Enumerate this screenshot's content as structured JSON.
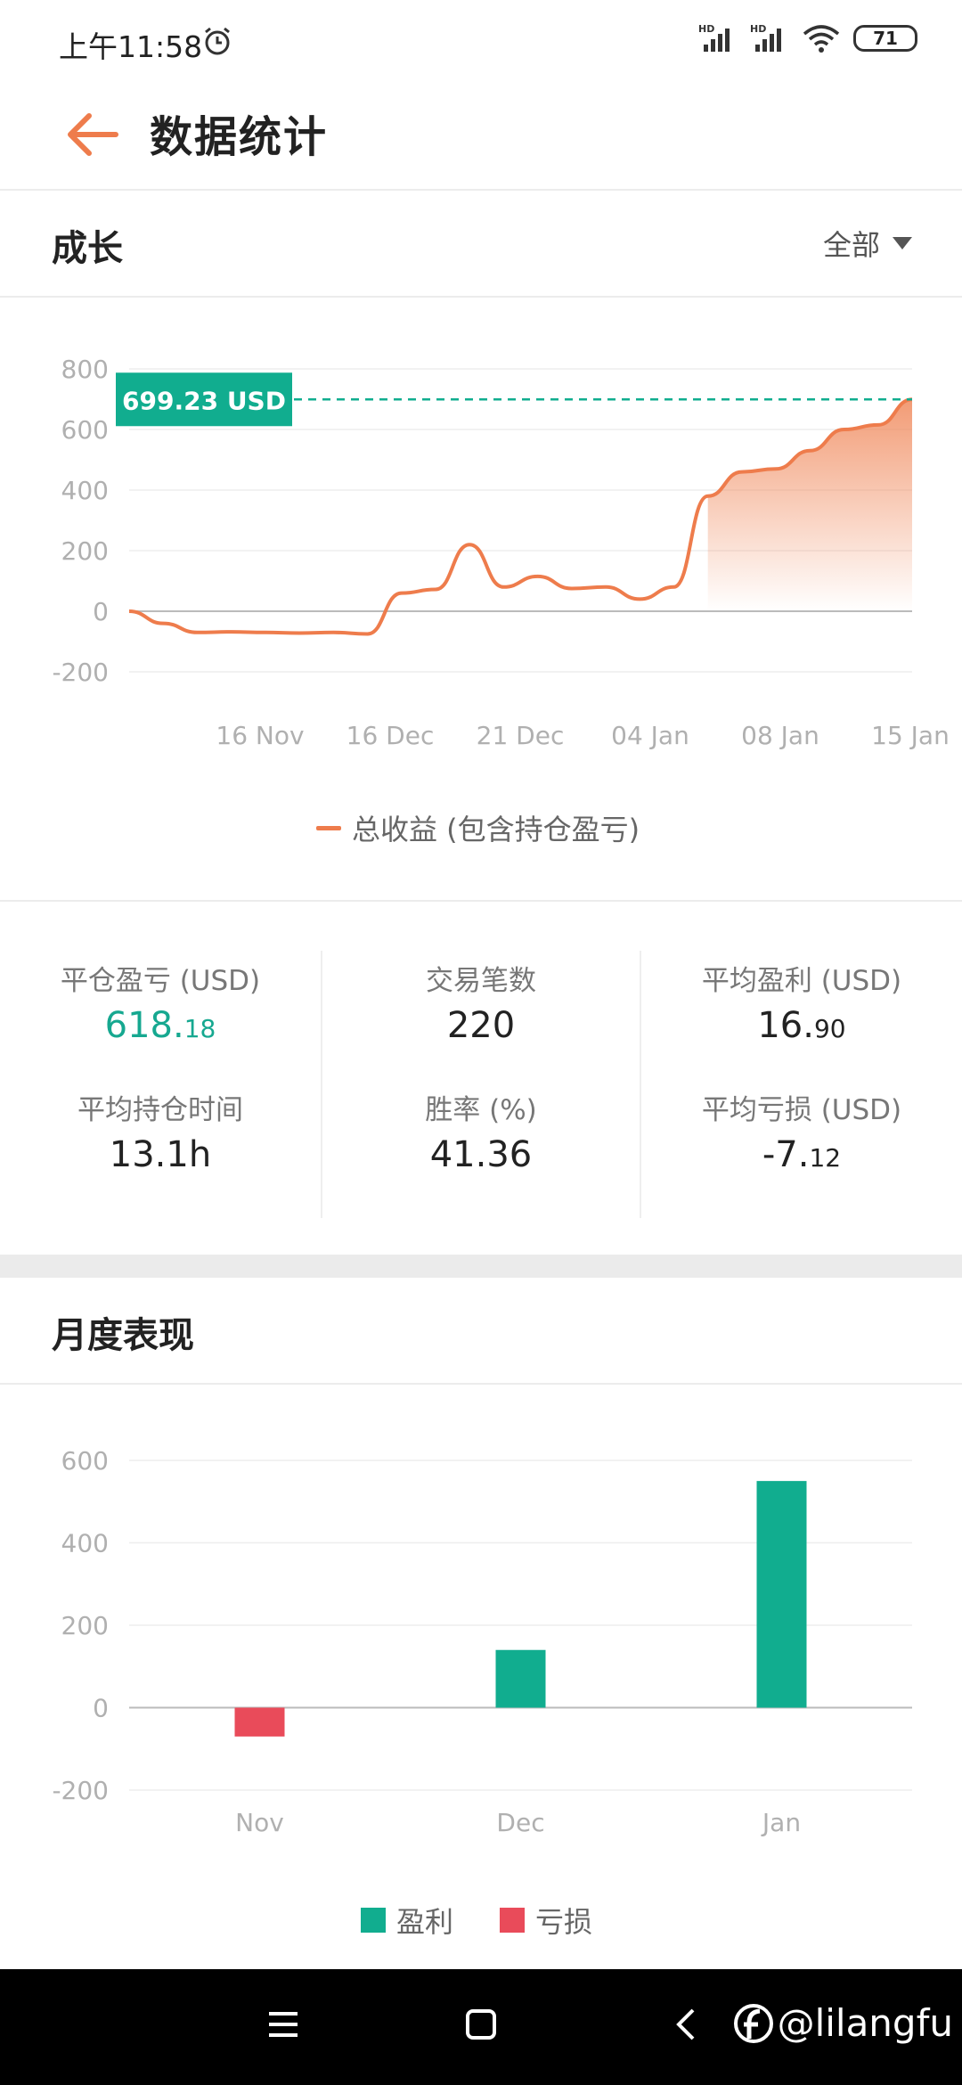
{
  "status_bar": {
    "time": "上午11:58",
    "battery": "71"
  },
  "header": {
    "title": "数据统计"
  },
  "growth": {
    "title": "成长",
    "filter": "全部",
    "current_value_label": "699.23 USD",
    "legend": "总收益 (包含持仓盈亏)"
  },
  "stats": {
    "closed_pnl_label": "平仓盈亏 (USD)",
    "closed_pnl_int": "618.",
    "closed_pnl_dec": "18",
    "trades_label": "交易笔数",
    "trades_value": "220",
    "avg_profit_label": "平均盈利 (USD)",
    "avg_profit_int": "16.",
    "avg_profit_dec": "90",
    "avg_hold_label": "平均持仓时间",
    "avg_hold_value": "13.1h",
    "win_rate_label": "胜率 (%)",
    "win_rate_value": "41.36",
    "avg_loss_label": "平均亏损 (USD)",
    "avg_loss_int": "-7.",
    "avg_loss_dec": "12"
  },
  "monthly": {
    "title": "月度表现",
    "legend_profit": "盈利",
    "legend_loss": "亏损"
  },
  "watermark": "@lilangfu",
  "colors": {
    "accent": "#ee7c4c",
    "profit": "#11ad8f",
    "loss": "#e94b5a"
  },
  "chart_data": [
    {
      "type": "area",
      "ylim": [
        -200,
        800
      ],
      "yticks": [
        "800",
        "600",
        "400",
        "200",
        "0",
        "-200"
      ],
      "xticks": [
        "16 Nov",
        "16 Dec",
        "21 Dec",
        "04 Jan",
        "08 Jan",
        "15 Jan"
      ],
      "series": [
        {
          "name": "总收益 (包含持仓盈亏)",
          "values": [
            0,
            -40,
            -70,
            -68,
            -70,
            -72,
            -70,
            -75,
            60,
            72,
            220,
            80,
            115,
            75,
            80,
            40,
            80,
            380,
            460,
            470,
            530,
            600,
            615,
            699.23
          ]
        }
      ]
    },
    {
      "type": "bar",
      "ylim": [
        -200,
        600
      ],
      "yticks": [
        "600",
        "400",
        "200",
        "0",
        "-200"
      ],
      "categories": [
        "Nov",
        "Dec",
        "Jan"
      ],
      "values": [
        -70,
        140,
        550
      ]
    }
  ]
}
